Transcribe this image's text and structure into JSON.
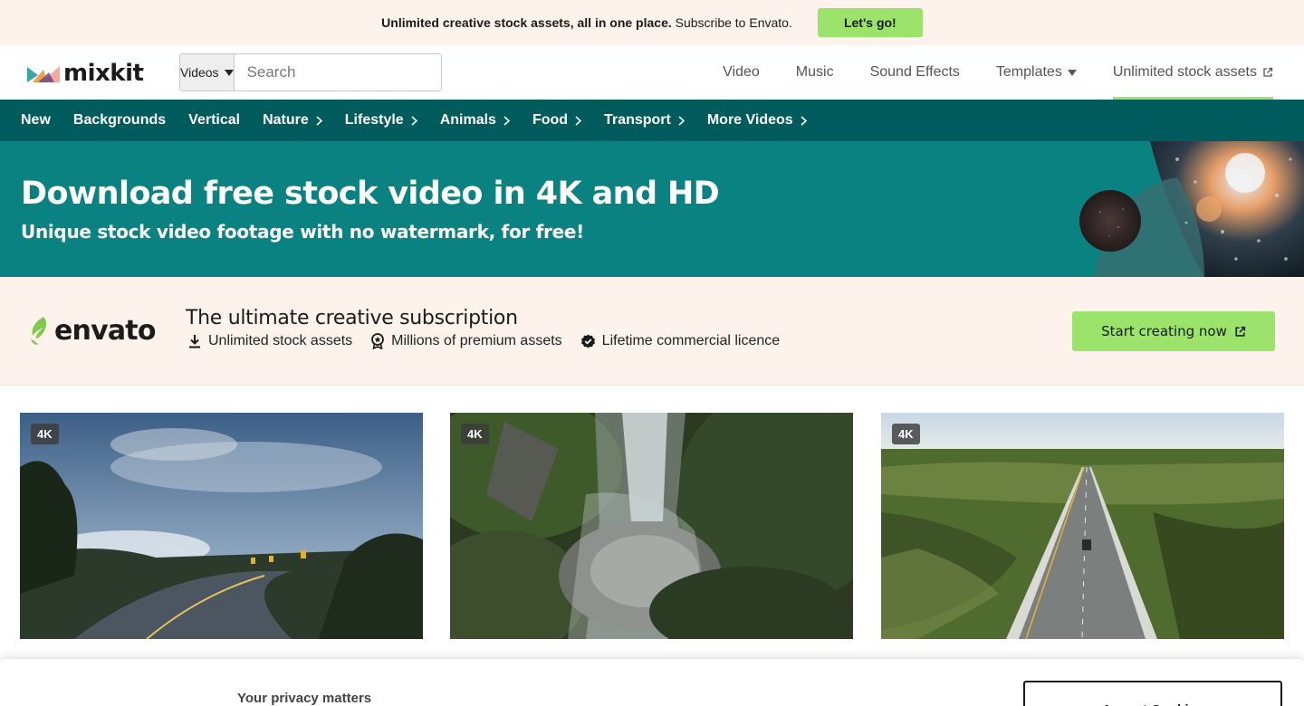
{
  "promo": {
    "bold_text": "Unlimited creative stock assets, all in one place.",
    "text": "Subscribe to Envato.",
    "button": "Let's go!"
  },
  "header": {
    "logo": "mixkit",
    "search": {
      "category": "Videos",
      "placeholder": "Search"
    },
    "nav": [
      {
        "label": "Video"
      },
      {
        "label": "Music"
      },
      {
        "label": "Sound Effects"
      },
      {
        "label": "Templates"
      },
      {
        "label": "Unlimited stock assets"
      }
    ]
  },
  "categories": [
    "New",
    "Backgrounds",
    "Vertical",
    "Nature",
    "Lifestyle",
    "Animals",
    "Food",
    "Transport",
    "More Videos"
  ],
  "hero": {
    "title": "Download free stock video in 4K and HD",
    "subtitle": "Unique stock video footage with no watermark, for free!"
  },
  "envato": {
    "logo": "envato",
    "title": "The ultimate creative subscription",
    "features": [
      "Unlimited stock assets",
      "Millions of premium assets",
      "Lifetime commercial licence"
    ],
    "button": "Start creating now"
  },
  "videos": [
    {
      "badge": "4K"
    },
    {
      "badge": "4K"
    },
    {
      "badge": "4K"
    }
  ],
  "cookie": {
    "title": "Your privacy matters",
    "button": "Accept Cookies"
  },
  "colors": {
    "accent_green": "#9be36b",
    "nav_teal": "#005c5c",
    "hero_teal": "#0a8282",
    "cream": "#fdf3ec"
  }
}
